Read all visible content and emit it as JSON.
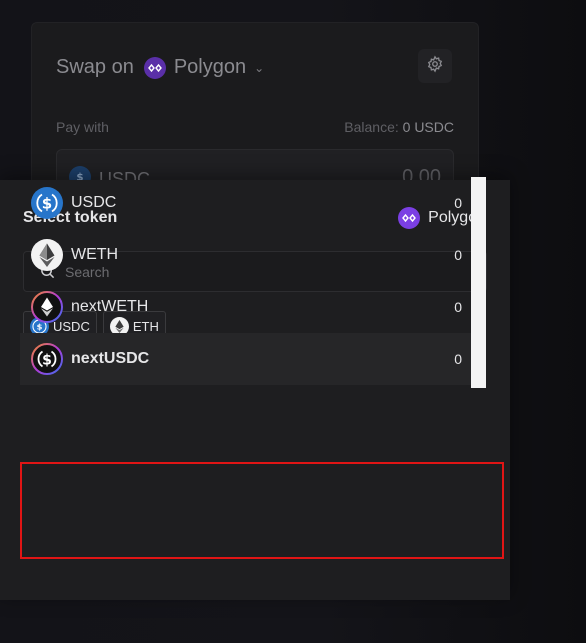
{
  "swap": {
    "title": "Swap on",
    "network": "Polygon",
    "pay_label": "Pay with",
    "balance_label": "Balance:",
    "balance_value": "0 USDC",
    "pay_token": "USDC",
    "pay_amount": "0.00"
  },
  "selector": {
    "title": "Select token",
    "network": "Polygon",
    "search_placeholder": "Search",
    "chips": [
      {
        "label": "USDC",
        "icon": "usdc-icon"
      },
      {
        "label": "ETH",
        "icon": "eth-icon"
      }
    ],
    "tokens": [
      {
        "name": "USDC",
        "balance": "0",
        "icon": "usdc-icon"
      },
      {
        "name": "WETH",
        "balance": "0",
        "icon": "weth-icon"
      },
      {
        "name": "nextWETH",
        "balance": "0",
        "icon": "next-weth-icon"
      },
      {
        "name": "nextUSDC",
        "balance": "0",
        "icon": "next-usdc-icon"
      }
    ]
  },
  "colors": {
    "polygon": "#7b3fe4",
    "usdc": "#2775ca",
    "highlight": "#e01515"
  }
}
